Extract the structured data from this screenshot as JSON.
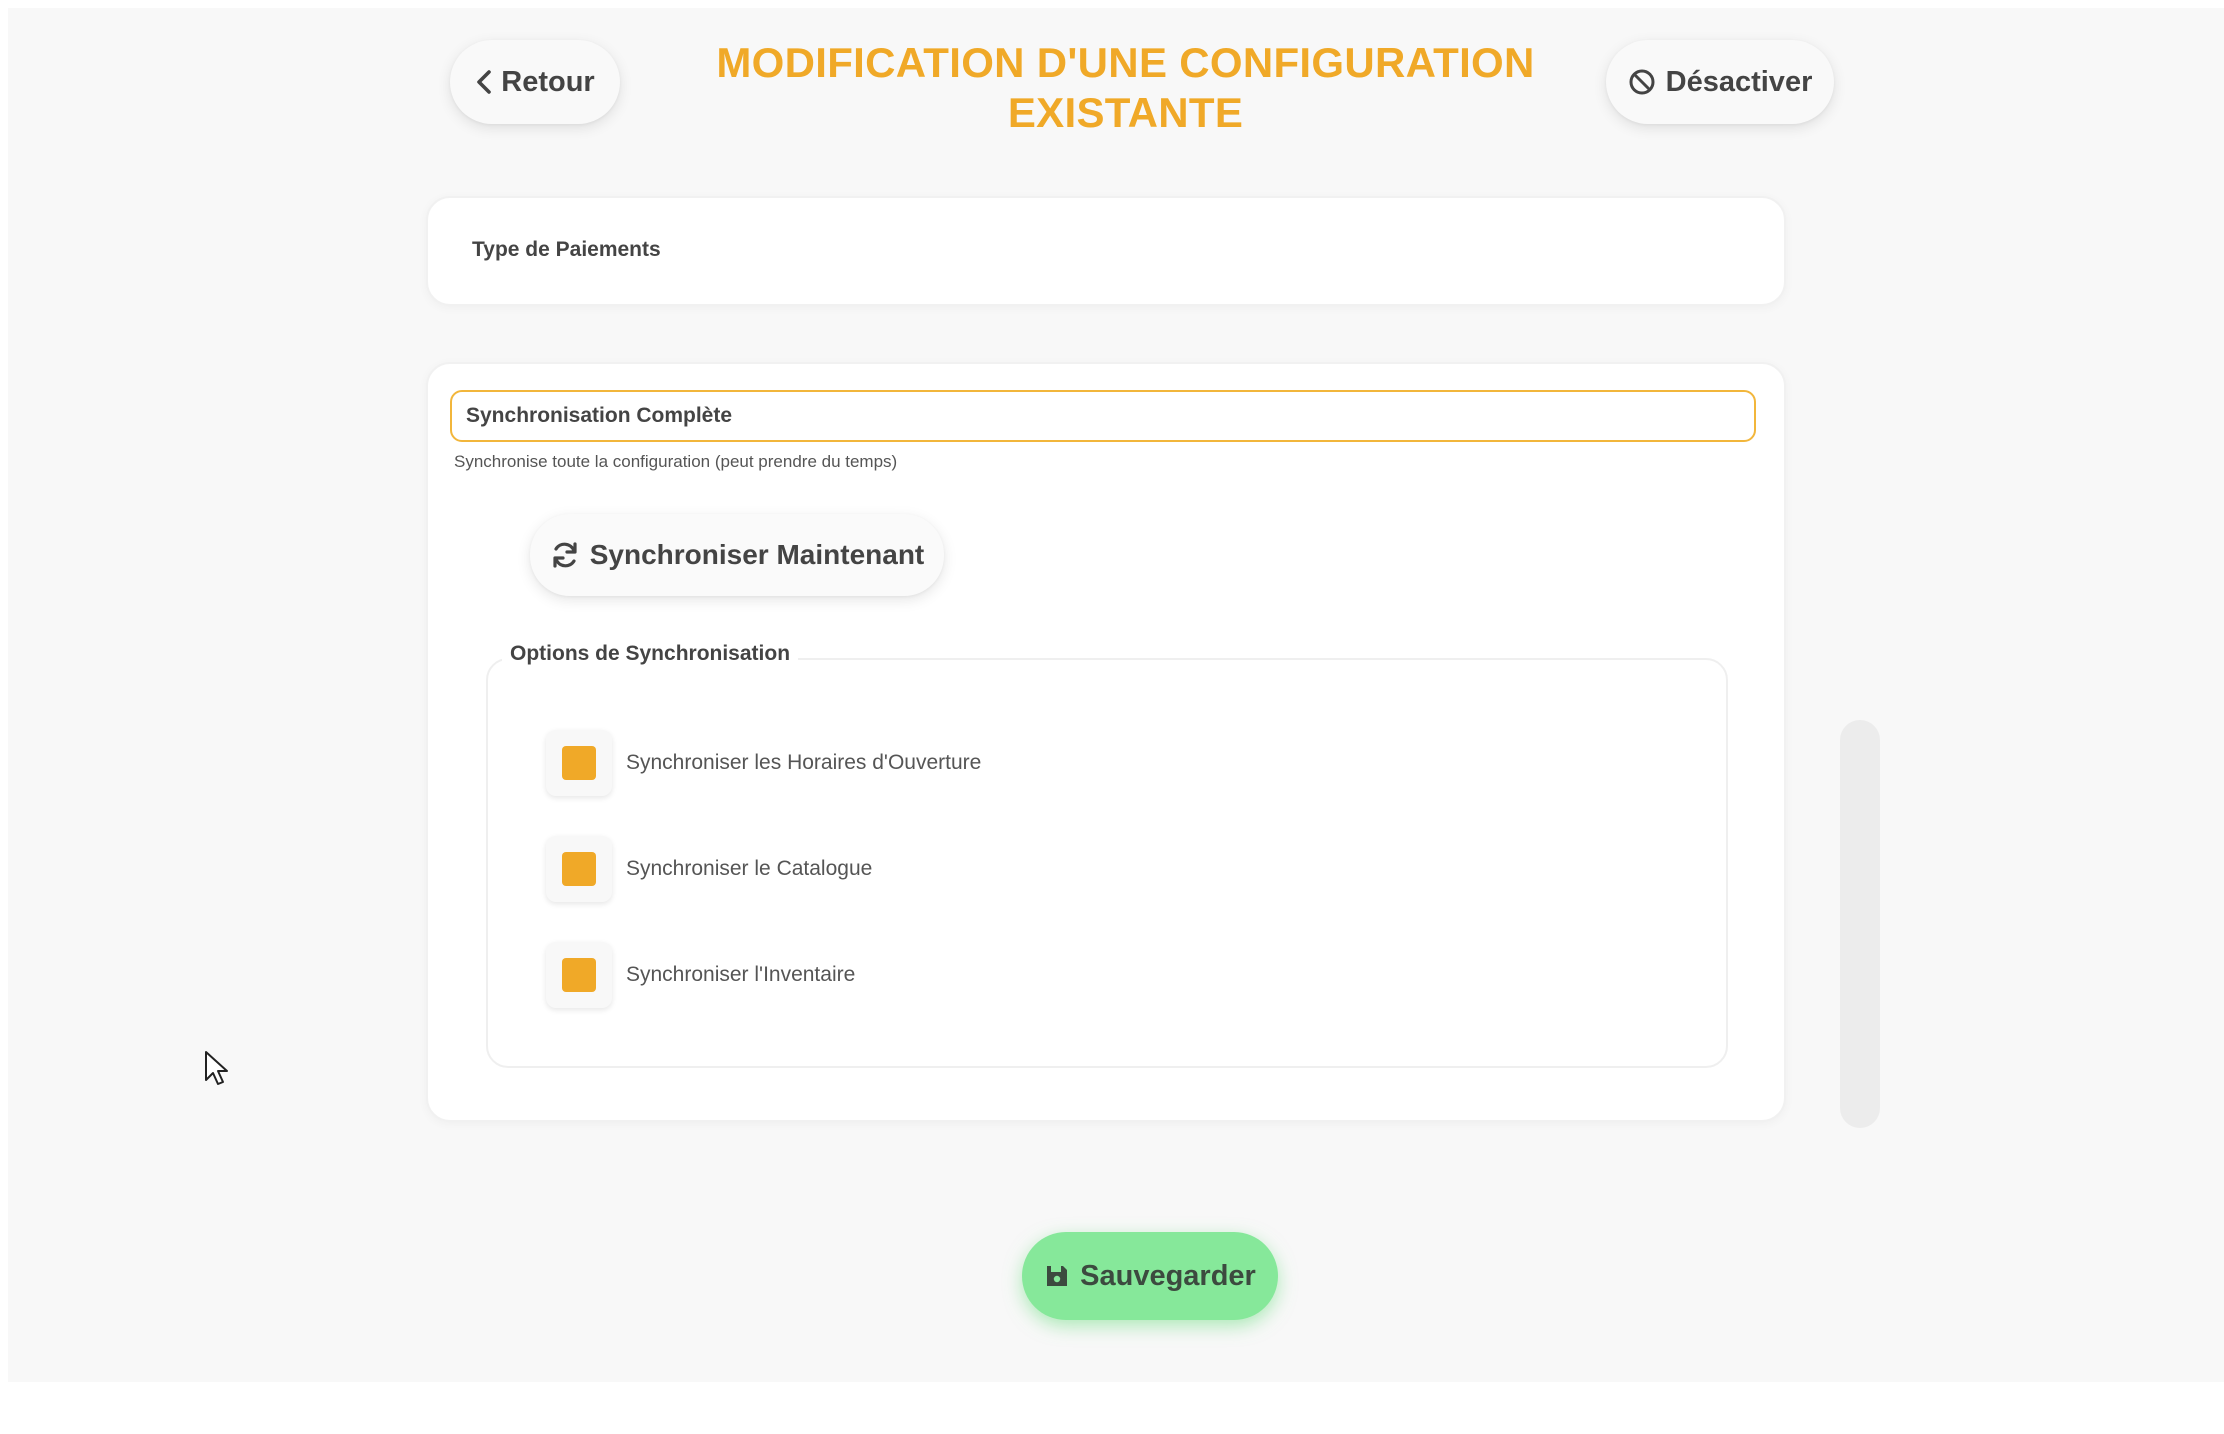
{
  "header": {
    "back_label": "Retour",
    "title": "MODIFICATION D'UNE CONFIGURATION EXISTANTE",
    "deactivate_label": "Désactiver"
  },
  "payment_type": {
    "label": "Type de Paiements"
  },
  "sync": {
    "selected_mode": "Synchronisation Complète",
    "help_text": "Synchronise toute la configuration (peut prendre du temps)",
    "sync_now_label": "Synchroniser Maintenant",
    "options_legend": "Options de Synchronisation",
    "options": [
      {
        "label": "Synchroniser les Horaires d'Ouverture",
        "checked": true
      },
      {
        "label": "Synchroniser le Catalogue",
        "checked": true
      },
      {
        "label": "Synchroniser l'Inventaire",
        "checked": true
      }
    ]
  },
  "footer": {
    "save_label": "Sauvegarder"
  },
  "colors": {
    "accent": "#f0a928",
    "save": "#86e89a",
    "background": "#f8f8f8"
  },
  "icons": {
    "back": "chevron-left-icon",
    "deactivate": "ban-icon",
    "sync": "sync-icon",
    "save": "floppy-disk-icon"
  }
}
